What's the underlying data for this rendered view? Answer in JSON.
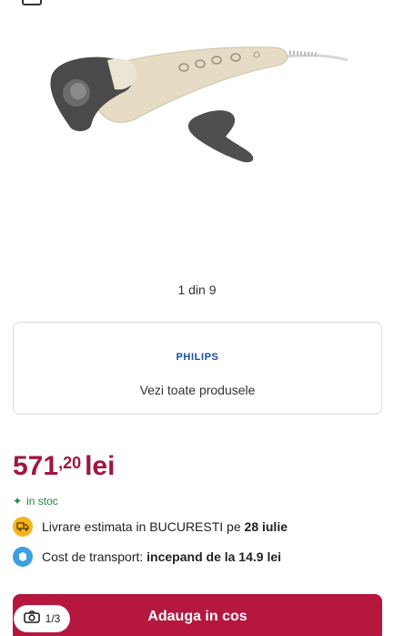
{
  "gallery": {
    "counter": "1 din 9",
    "pill_count": "1/3"
  },
  "brand": {
    "logo_text": "PHILIPS",
    "link_text": "Vezi toate produsele"
  },
  "price": {
    "integer": "571",
    "decimal": ",20",
    "currency": "lei"
  },
  "stock": {
    "label": "in stoc"
  },
  "delivery": {
    "prefix": "Livrare estimata in BUCURESTI pe ",
    "date": "28 iulie"
  },
  "shipping": {
    "prefix": "Cost de transport: ",
    "value": "incepand de la 14.9 lei"
  },
  "cta": {
    "add_to_cart": "Adauga in cos"
  },
  "colors": {
    "price": "#a0163e",
    "cta_bg": "#b5173f",
    "stock": "#1e8a3a",
    "brand": "#1a4da1"
  }
}
